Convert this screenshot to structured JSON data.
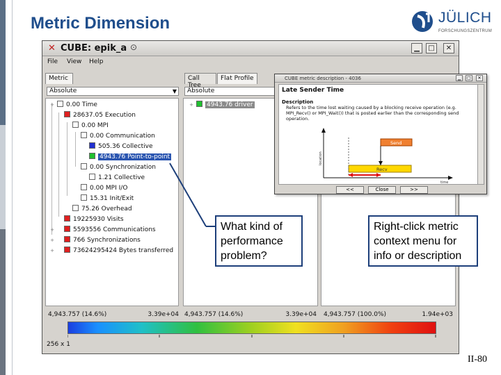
{
  "slide": {
    "title": "Metric Dimension",
    "logo_name": "JÜLICH",
    "logo_sub": "FORSCHUNGSZENTRUM",
    "page_number": "II-80",
    "colors": {
      "title": "#1f4e8c",
      "callout_border": "#1d3f7a"
    }
  },
  "window": {
    "title": "CUBE: epik_a",
    "menu": [
      "File",
      "View",
      "Help"
    ],
    "controls": {
      "minimize": "▁",
      "maximize": "□",
      "close": "✕"
    }
  },
  "metric_panel": {
    "tab": "Metric",
    "mode": "Absolute",
    "tree": [
      {
        "value": "0.00",
        "label": "Time",
        "color": "#ffffff",
        "expander": "+"
      },
      {
        "value": "28637.05",
        "label": "Execution",
        "color": "#e02020",
        "expander": "-"
      },
      {
        "value": "0.00",
        "label": "MPI",
        "color": "#ffffff",
        "expander": "-"
      },
      {
        "value": "0.00",
        "label": "Communication",
        "color": "#ffffff",
        "expander": "-"
      },
      {
        "value": "505.36",
        "label": "Collective",
        "color": "#2030d0",
        "expander": ""
      },
      {
        "value": "4943.76",
        "label": "Point-to-point",
        "color": "#20c030",
        "expander": "",
        "selected": true
      },
      {
        "value": "0.00",
        "label": "Synchronization",
        "color": "#ffffff",
        "expander": "+"
      },
      {
        "value": "1.21",
        "label": "Collective",
        "color": "#ffffff",
        "expander": ""
      },
      {
        "value": "0.00",
        "label": "MPI I/O",
        "color": "#ffffff",
        "expander": ""
      },
      {
        "value": "15.31",
        "label": "Init/Exit",
        "color": "#ffffff",
        "expander": ""
      },
      {
        "value": "75.26",
        "label": "Overhead",
        "color": "#ffffff",
        "expander": ""
      },
      {
        "value": "19225930",
        "label": "Visits",
        "color": "#e02020",
        "expander": ""
      },
      {
        "value": "5593556",
        "label": "Communications",
        "color": "#e02020",
        "expander": "+"
      },
      {
        "value": "766",
        "label": "Synchronizations",
        "color": "#e02020",
        "expander": "+"
      },
      {
        "value": "73624295424",
        "label": "Bytes transferred",
        "color": "#e02020",
        "expander": "+"
      }
    ],
    "status_value": "4,943.757",
    "status_percent": "(14.6%)",
    "status_max": "3.39e+04"
  },
  "call_panel": {
    "tabs": [
      "Call Tree",
      "Flat Profile"
    ],
    "mode": "Absolute",
    "tree": [
      {
        "value": "4943.76",
        "label": "driver",
        "color": "#20c030",
        "expander": "+"
      }
    ],
    "status_value": "4,943.757",
    "status_percent": "(14.6%)",
    "status_max": "3.39e+04"
  },
  "system_panel": {
    "status_value": "4,943.757",
    "status_percent": "(100.0%)",
    "status_max": "1.94e+03"
  },
  "footer": {
    "color_range": "256 x 1"
  },
  "dialog": {
    "title": "CUBE metric description - 4036",
    "heading": "Late Sender Time",
    "section": "Description",
    "text": "Refers to the time lost waiting caused by a blocking receive operation (e.g. MPI_Recv() or MPI_Wait()) that is posted earlier than the corresponding send operation.",
    "diagram": {
      "send_label": "Send",
      "recv_label": "Recv",
      "y_label": "location",
      "x_label": "time"
    },
    "buttons": [
      "<<",
      "Close",
      ">>"
    ]
  },
  "callouts": {
    "left": "What kind of performance problem?",
    "right": "Right-click metric context menu for info or description"
  }
}
